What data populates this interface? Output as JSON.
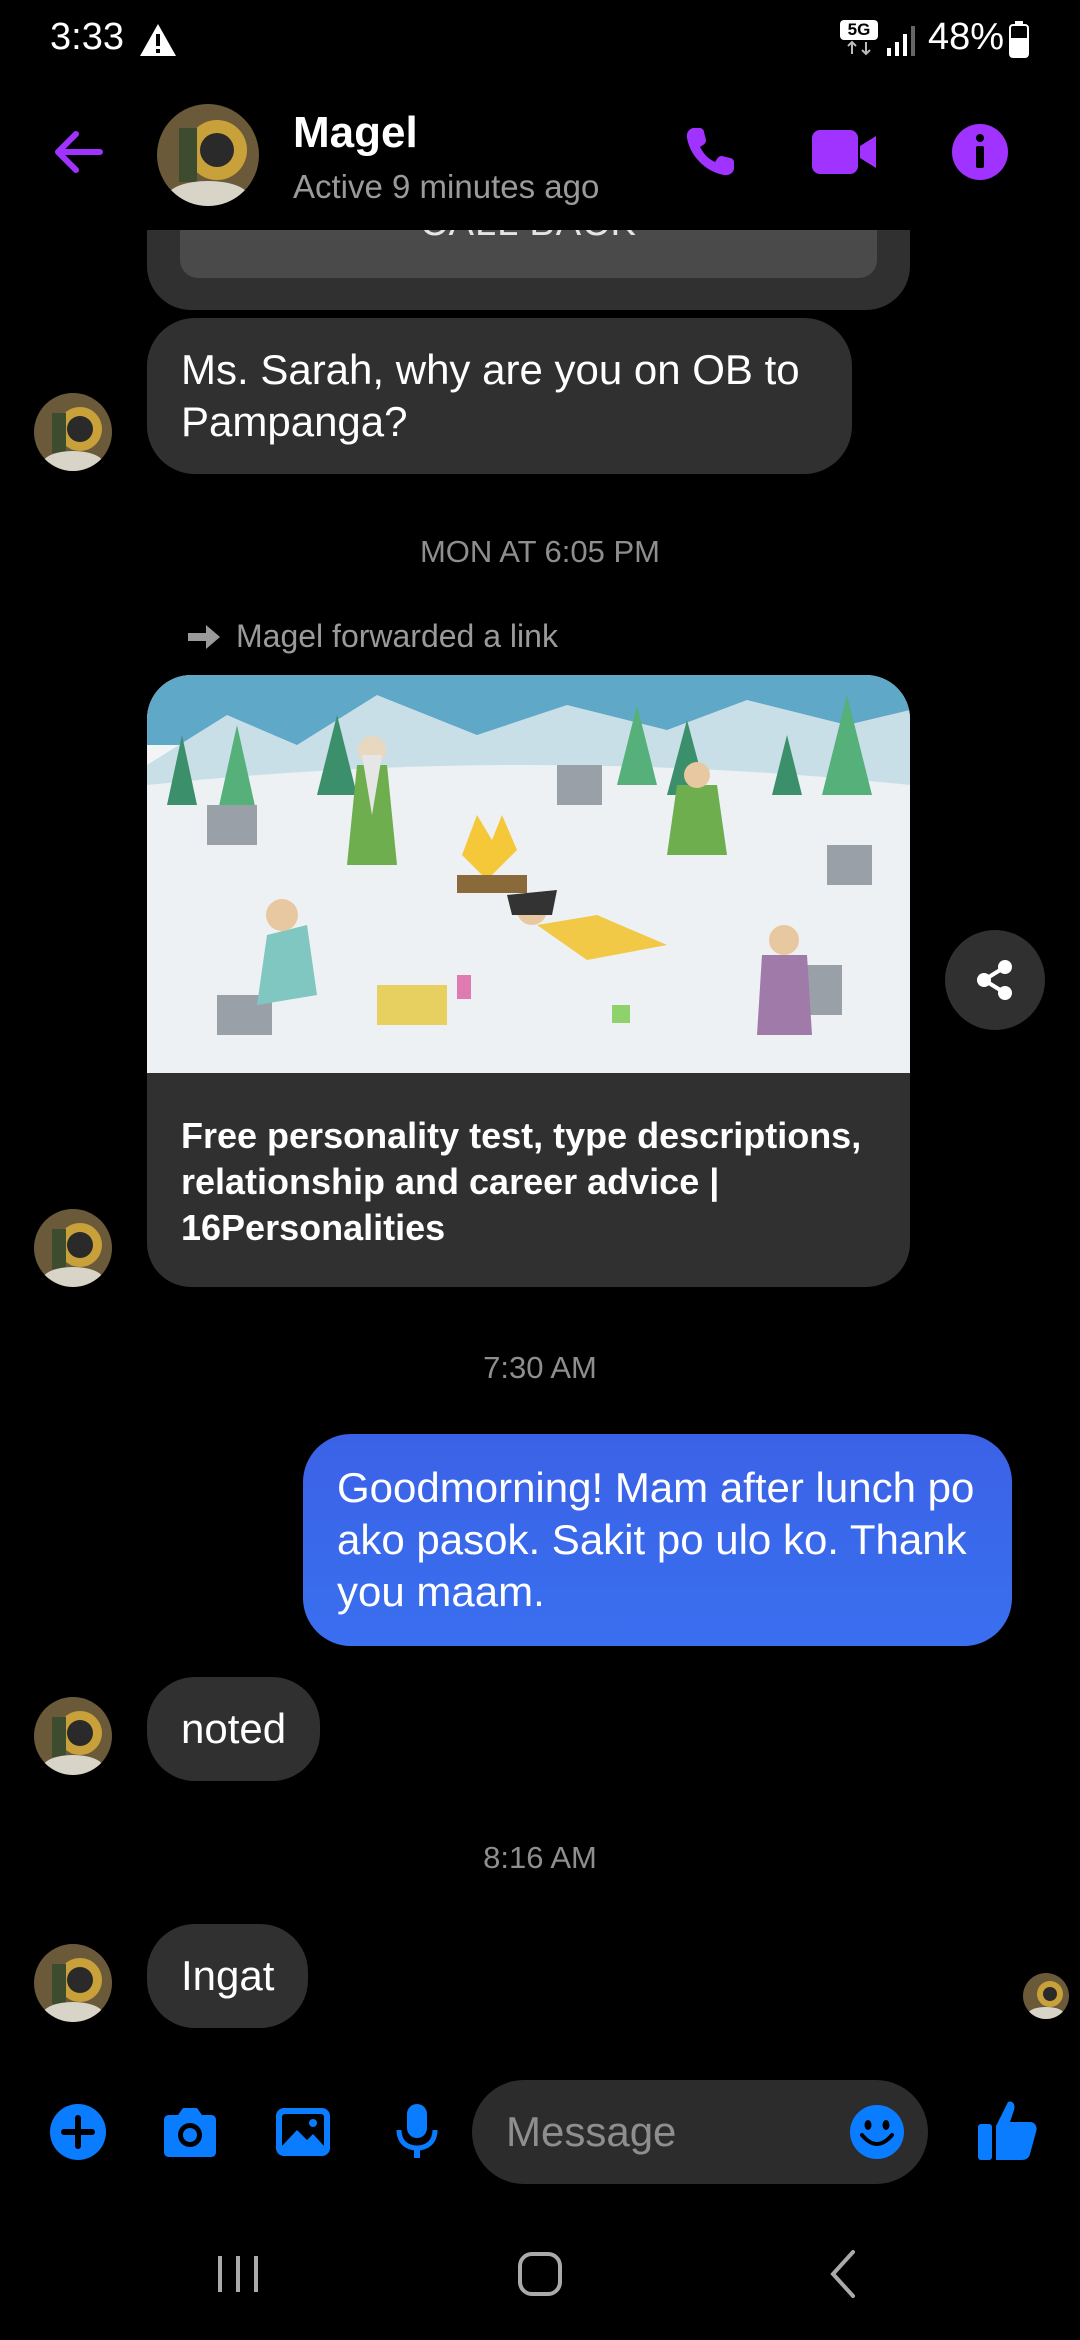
{
  "status_bar": {
    "time": "3:33",
    "network": "5G",
    "battery": "48%"
  },
  "header": {
    "name": "Magel",
    "status": "Active 9 minutes ago"
  },
  "conversation": {
    "callback_label": "CALL BACK",
    "msg1": "Ms. Sarah, why are you on OB to Pampanga?",
    "ts1": "MON AT 6:05 PM",
    "forward_note": "Magel forwarded a link",
    "link_title": "Free personality test, type descriptions, relationship and career advice | 16Personalities",
    "ts2": "7:30 AM",
    "msg_out": "Goodmorning! Mam after lunch po ako pasok. Sakit po ulo ko. Thank you maam.",
    "msg2": "noted",
    "ts3": "8:16 AM",
    "msg3": "Ingat"
  },
  "composer": {
    "placeholder": "Message"
  },
  "colors": {
    "accent_purple": "#a033ff",
    "accent_blue": "#0a7cff",
    "outgoing_bubble": "#3b66ec",
    "incoming_bubble": "#303030"
  },
  "icons": [
    "warning-icon",
    "signal-icon",
    "battery-icon",
    "back-arrow-icon",
    "phone-icon",
    "video-camera-icon",
    "info-icon",
    "forward-arrow-icon",
    "share-icon",
    "plus-icon",
    "camera-icon",
    "gallery-icon",
    "microphone-icon",
    "emoji-icon",
    "thumbs-up-icon",
    "recents-icon",
    "home-icon",
    "back-icon"
  ]
}
